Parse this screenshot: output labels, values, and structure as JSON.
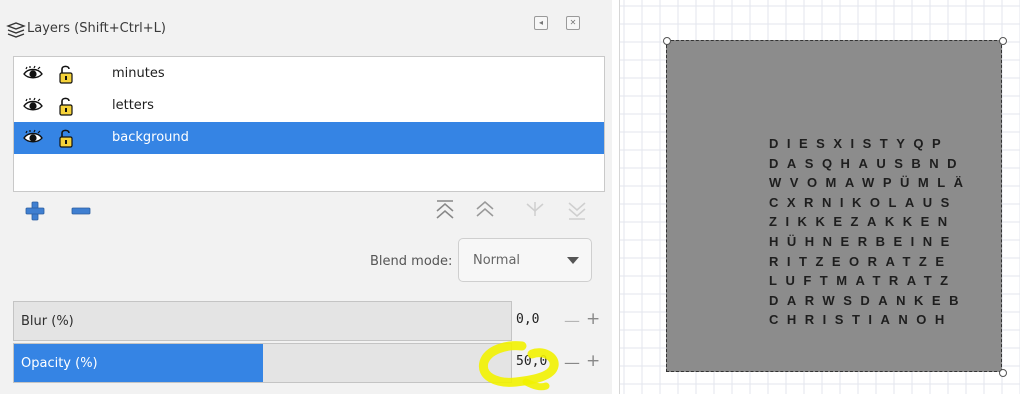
{
  "panel": {
    "title": "Layers (Shift+Ctrl+L)",
    "layers": [
      {
        "name": "minutes",
        "visible": true,
        "locked": false,
        "selected": false
      },
      {
        "name": "letters",
        "visible": true,
        "locked": false,
        "selected": false
      },
      {
        "name": "background",
        "visible": true,
        "locked": false,
        "selected": true
      }
    ],
    "blend": {
      "label": "Blend mode:",
      "value": "Normal"
    },
    "blur": {
      "label": "Blur (%)",
      "value": "0,0",
      "fraction": 0.0
    },
    "opacity": {
      "label": "Opacity (%)",
      "value": "50,0",
      "fraction": 0.5
    },
    "stepper": {
      "minus": "—",
      "plus": "+"
    }
  },
  "colors": {
    "accent": "#3584e4",
    "highlight": "#f2f200",
    "canvas_rect": "#8c8c8c"
  },
  "icons": [
    "layers-icon",
    "eye-icon",
    "unlock-icon",
    "add-layer-icon",
    "remove-layer-icon",
    "raise-to-top-icon",
    "raise-icon",
    "lower-icon",
    "lower-to-bottom-icon"
  ],
  "canvas": {
    "letter_rows": [
      "DIESXISTYQP",
      "DASQHAUSBND",
      "WVOMAWPÜMLÄ",
      "CXRNIKOLAUS",
      "ZIKKEZAKKEN",
      "HÜHNERBEINE",
      "RITZEORATZE",
      "LUFTMATRATZ",
      "DARWSDANKEB",
      "CHRISTIANOH"
    ]
  }
}
